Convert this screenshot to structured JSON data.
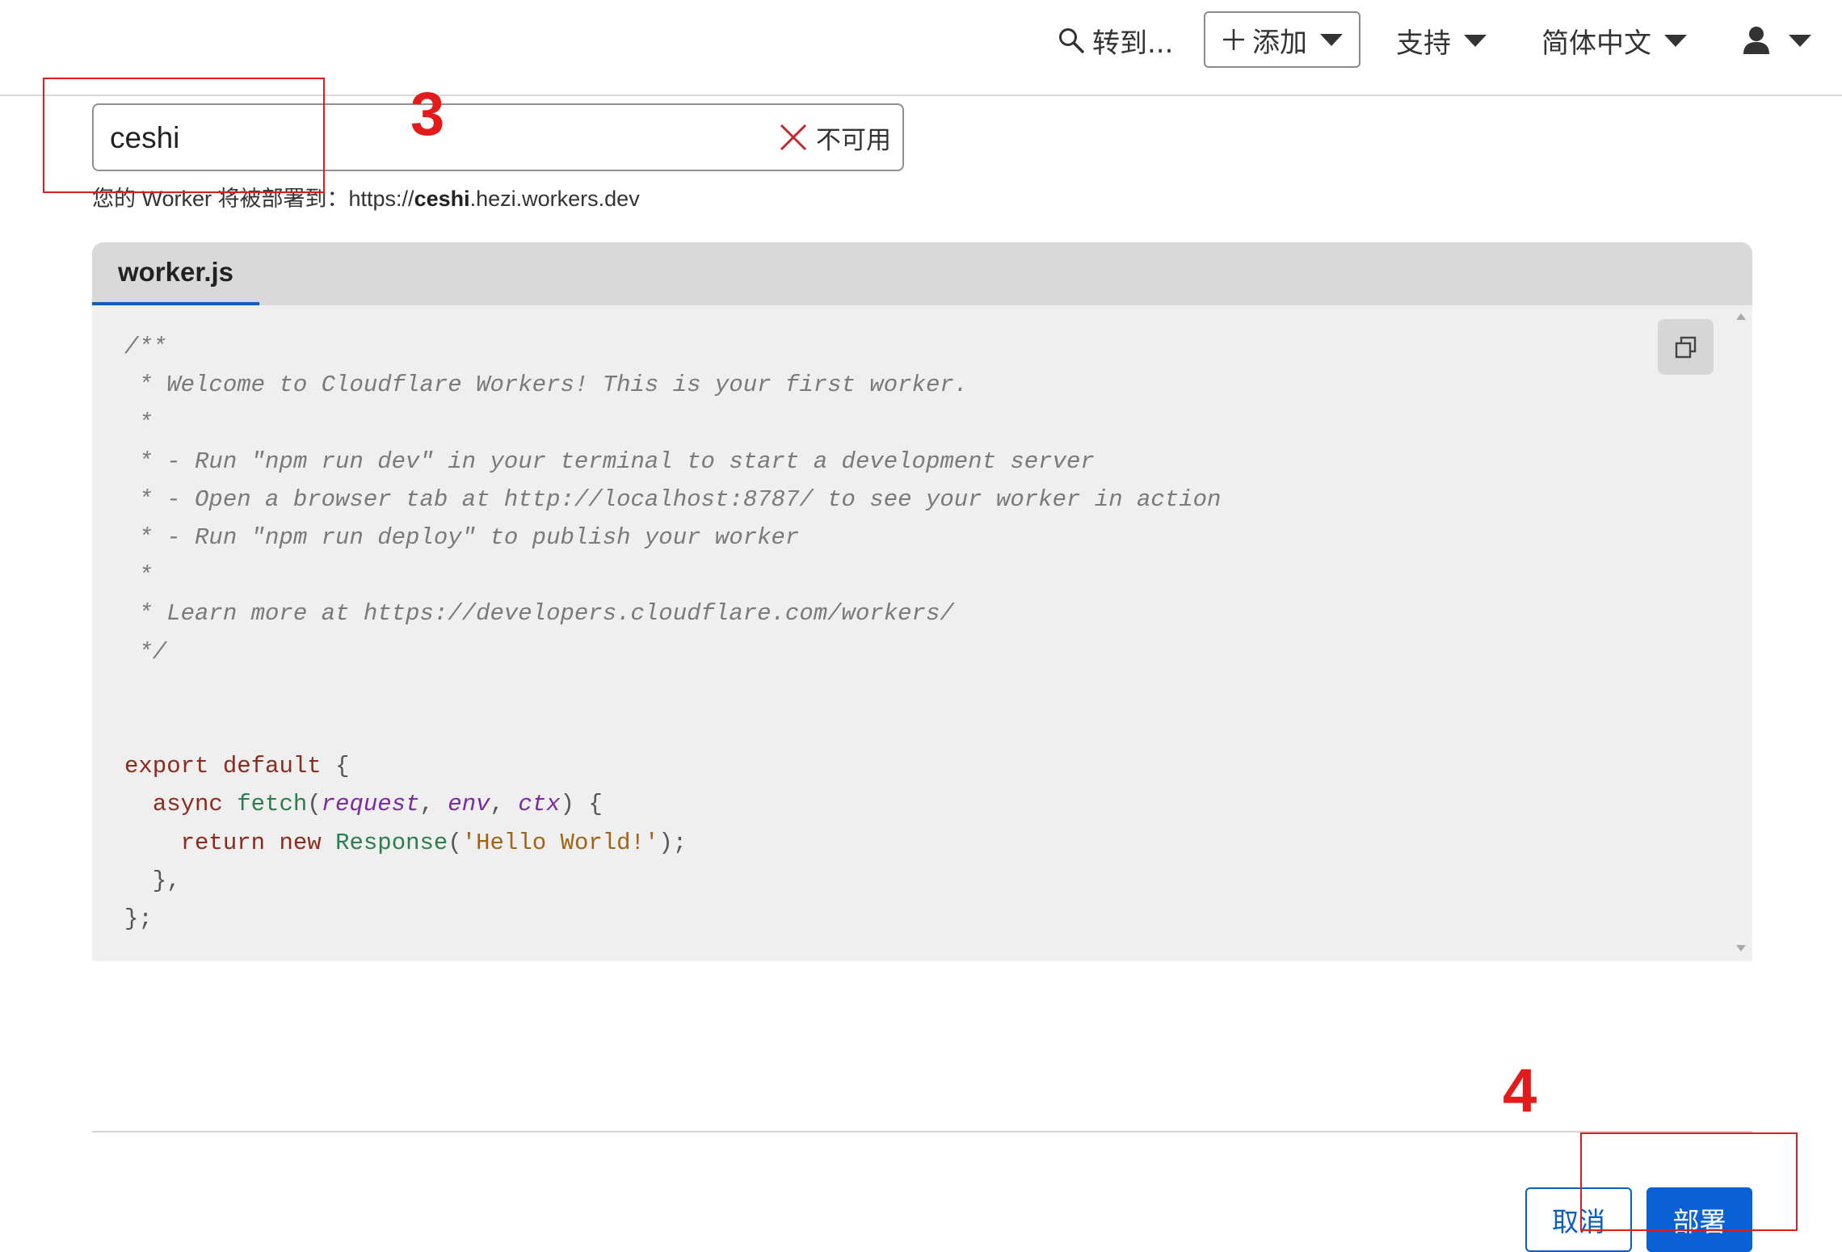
{
  "header": {
    "search_label": "转到...",
    "add_label": "添加",
    "support_label": "支持",
    "language_label": "简体中文"
  },
  "name_field": {
    "value": "ceshi",
    "status_text": "不可用"
  },
  "deploy_hint": {
    "prefix": "您的 Worker 将被部署到：",
    "scheme": "https://",
    "name": "ceshi",
    "domain": ".hezi.workers.dev"
  },
  "editor": {
    "tab_label": "worker.js",
    "code_lines": [
      "/**",
      " * Welcome to Cloudflare Workers! This is your first worker.",
      " *",
      " * - Run \"npm run dev\" in your terminal to start a development server",
      " * - Open a browser tab at http://localhost:8787/ to see your worker in action",
      " * - Run \"npm run deploy\" to publish your worker",
      " *",
      " * Learn more at https://developers.cloudflare.com/workers/",
      " */",
      "",
      "",
      "export default {",
      "  async fetch(request, env, ctx) {",
      "    return new Response('Hello World!');",
      "  },",
      "};"
    ]
  },
  "footer": {
    "cancel_label": "取消",
    "deploy_label": "部署"
  },
  "annotations": {
    "step_name": "3",
    "step_deploy": "4",
    "color": "#e31b1b"
  },
  "colors": {
    "primary": "#0a61d6",
    "status_error": "#c62828"
  }
}
